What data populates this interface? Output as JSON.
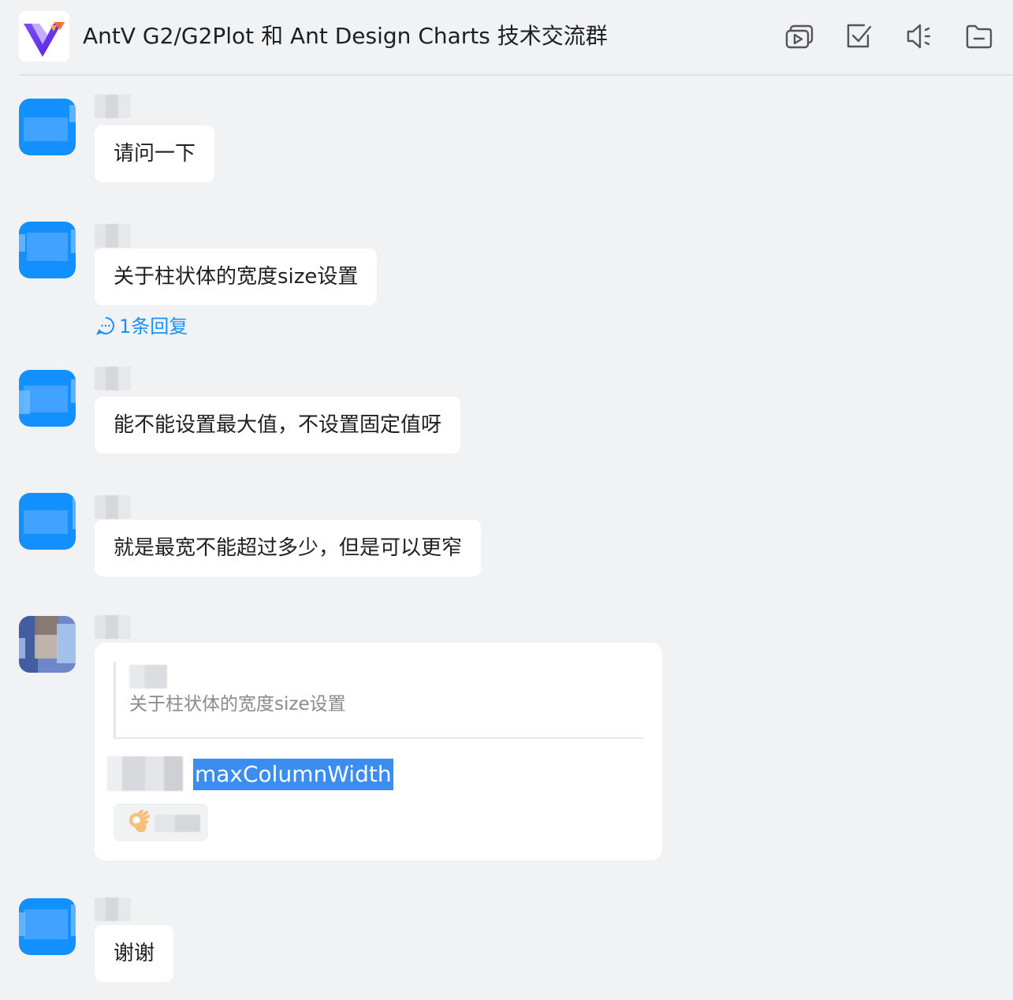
{
  "header": {
    "title": "AntV G2/G2Plot 和 Ant Design Charts 技术交流群",
    "icons": [
      "video-icon",
      "checkbox-icon",
      "speaker-icon",
      "folder-icon"
    ]
  },
  "messages": [
    {
      "text": "请问一下"
    },
    {
      "text": "关于柱状体的宽度size设置",
      "reply_count_label": "1条回复"
    },
    {
      "text": "能不能设置最大值，不设置固定值呀"
    },
    {
      "text": "就是最宽不能超过多少，但是可以更窄"
    },
    {
      "quote_text": "关于柱状体的宽度size设置",
      "highlight_text": "maxColumnWidth",
      "reaction_emoji": "ok-hand-emoji"
    },
    {
      "text": "谢谢"
    }
  ],
  "colors": {
    "accent": "#1890ff",
    "avatar": "#1290ff",
    "background": "#f1f2f4",
    "highlight": "#3b8ef0"
  }
}
